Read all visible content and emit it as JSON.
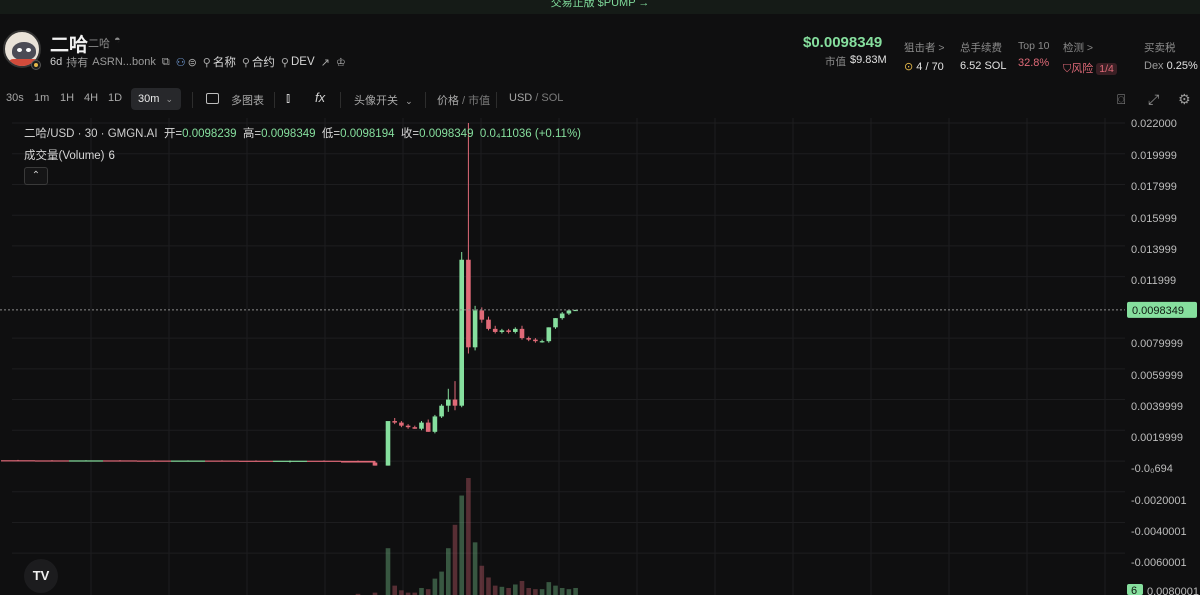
{
  "banner": {
    "text": "交易正版 $PUMP →"
  },
  "token": {
    "name": "二哈",
    "sub_name": "二哈",
    "age": "6d",
    "holders_label": "持有",
    "address": "ASRN...bonk",
    "name_search_label": "名称",
    "contract_label": "合约",
    "dev_label": "DEV"
  },
  "price": {
    "value": "$0.0098349",
    "mcap_label": "市值",
    "mcap_value": "$9.83M"
  },
  "stats": [
    {
      "header": "狙击者 >",
      "value": "4 / 70"
    },
    {
      "header": "总手续费",
      "value": "6.52 SOL"
    },
    {
      "header": "Top 10",
      "value": "32.8%"
    },
    {
      "header": "检测 >",
      "value": "风险",
      "badge": "1/4"
    },
    {
      "header": "买卖税",
      "value_prefix": "Dex",
      "value": "0.25%"
    }
  ],
  "toolbar": {
    "intervals": [
      "30s",
      "1m",
      "1H",
      "4H",
      "1D"
    ],
    "active_interval": "30m",
    "multi_chart": "多图表",
    "avatar_toggle": "头像开关",
    "price_label": "价格",
    "mcap_label": "市值",
    "currency_usd": "USD",
    "currency_sol": "SOL"
  },
  "chart": {
    "legend_symbol": "二哈/USD · 30 · GMGN.AI",
    "open_label": "开=",
    "open": "0.0098239",
    "high_label": "高=",
    "high": "0.0098349",
    "low_label": "低=",
    "low": "0.0098194",
    "close_label": "收=",
    "close": "0.0098349",
    "change": "0.0₄11036 (+0.11%)",
    "volume_label": "成交量(Volume)",
    "volume_value": "6",
    "current_price_tag": "0.0098349",
    "volume_tag": "6",
    "y_ticks": [
      "0.022000",
      "0.019999",
      "0.017999",
      "0.015999",
      "0.013999",
      "0.011999",
      "0.0079999",
      "0.0059999",
      "0.0039999",
      "0.0019999",
      "-0.0₀694",
      "-0.0020001",
      "-0.0040001",
      "-0.0060001",
      "0.0080001"
    ],
    "up_color": "#86df9e",
    "down_color": "#e06a78"
  },
  "chart_data": {
    "type": "candlestick",
    "ylim": [
      -0.0075,
      0.0225
    ],
    "candles": [
      {
        "o": 5e-05,
        "h": 7e-05,
        "l": 3e-05,
        "c": 4e-05
      },
      {
        "o": 4e-05,
        "h": 6e-05,
        "l": 2e-05,
        "c": 3e-05
      },
      {
        "o": 3e-05,
        "h": 5e-05,
        "l": 1e-05,
        "c": 4e-05
      },
      {
        "o": 4e-05,
        "h": 6e-05,
        "l": 2e-05,
        "c": 3e-05
      },
      {
        "o": 3e-05,
        "h": 5e-05,
        "l": 1e-05,
        "c": 2e-05
      },
      {
        "o": 2e-05,
        "h": 4e-05,
        "l": 0.0,
        "c": 3e-05
      },
      {
        "o": 3e-05,
        "h": 5e-05,
        "l": 1e-05,
        "c": 2e-05
      },
      {
        "o": 2e-05,
        "h": 4e-05,
        "l": 0.0,
        "c": 1e-05
      },
      {
        "o": 1e-05,
        "h": 3e-05,
        "l": -0.0001,
        "c": 2e-05
      },
      {
        "o": 2e-05,
        "h": 4e-05,
        "l": 0.0,
        "c": 1e-05
      },
      {
        "o": 1e-05,
        "h": 3e-05,
        "l": -0.0001,
        "c": -0.0001
      },
      {
        "o": -0.0001,
        "h": 0.0,
        "l": -0.0003,
        "c": -0.0003
      },
      {
        "o": -0.0003,
        "h": 0.0,
        "l": -0.0003,
        "c": 0.0026
      },
      {
        "o": 0.0026,
        "h": 0.0028,
        "l": 0.0024,
        "c": 0.0025
      },
      {
        "o": 0.0025,
        "h": 0.0026,
        "l": 0.0022,
        "c": 0.0023
      },
      {
        "o": 0.0023,
        "h": 0.0024,
        "l": 0.0021,
        "c": 0.0022
      },
      {
        "o": 0.0022,
        "h": 0.0023,
        "l": 0.0021,
        "c": 0.0021
      },
      {
        "o": 0.0021,
        "h": 0.0026,
        "l": 0.002,
        "c": 0.0025
      },
      {
        "o": 0.0025,
        "h": 0.0027,
        "l": 0.0019,
        "c": 0.0019
      },
      {
        "o": 0.0019,
        "h": 0.003,
        "l": 0.0018,
        "c": 0.0029
      },
      {
        "o": 0.0029,
        "h": 0.0037,
        "l": 0.0028,
        "c": 0.0036
      },
      {
        "o": 0.0036,
        "h": 0.0047,
        "l": 0.0032,
        "c": 0.004
      },
      {
        "o": 0.004,
        "h": 0.0052,
        "l": 0.0033,
        "c": 0.0036
      },
      {
        "o": 0.0036,
        "h": 0.0136,
        "l": 0.0035,
        "c": 0.0131
      },
      {
        "o": 0.0131,
        "h": 0.022,
        "l": 0.007,
        "c": 0.0074
      },
      {
        "o": 0.0074,
        "h": 0.0101,
        "l": 0.0072,
        "c": 0.0098
      },
      {
        "o": 0.0098,
        "h": 0.01,
        "l": 0.009,
        "c": 0.0092
      },
      {
        "o": 0.0092,
        "h": 0.0094,
        "l": 0.0085,
        "c": 0.0086
      },
      {
        "o": 0.0086,
        "h": 0.0088,
        "l": 0.0083,
        "c": 0.0084
      },
      {
        "o": 0.0084,
        "h": 0.0086,
        "l": 0.0083,
        "c": 0.0085
      },
      {
        "o": 0.0085,
        "h": 0.0086,
        "l": 0.0083,
        "c": 0.0084
      },
      {
        "o": 0.0084,
        "h": 0.0087,
        "l": 0.0083,
        "c": 0.0086
      },
      {
        "o": 0.0086,
        "h": 0.0088,
        "l": 0.0079,
        "c": 0.008
      },
      {
        "o": 0.008,
        "h": 0.0081,
        "l": 0.0078,
        "c": 0.0079
      },
      {
        "o": 0.0079,
        "h": 0.008,
        "l": 0.0077,
        "c": 0.0078
      },
      {
        "o": 0.0078,
        "h": 0.0079,
        "l": 0.0077,
        "c": 0.0078
      },
      {
        "o": 0.0078,
        "h": 0.0087,
        "l": 0.0077,
        "c": 0.0087
      },
      {
        "o": 0.0087,
        "h": 0.0093,
        "l": 0.0086,
        "c": 0.0093
      },
      {
        "o": 0.0093,
        "h": 0.0097,
        "l": 0.0092,
        "c": 0.0096
      },
      {
        "o": 0.0096,
        "h": 0.0098,
        "l": 0.0095,
        "c": 0.0098
      },
      {
        "o": 0.0098239,
        "h": 0.0098349,
        "l": 0.0098194,
        "c": 0.0098349
      }
    ],
    "volumes": [
      0,
      0,
      0,
      0,
      0,
      0,
      0,
      0,
      0,
      0,
      1,
      2,
      40,
      8,
      4,
      2,
      2,
      6,
      5,
      14,
      20,
      40,
      60,
      85,
      100,
      45,
      25,
      15,
      8,
      7,
      6,
      9,
      12,
      6,
      5,
      5,
      11,
      8,
      6,
      5,
      6
    ]
  }
}
